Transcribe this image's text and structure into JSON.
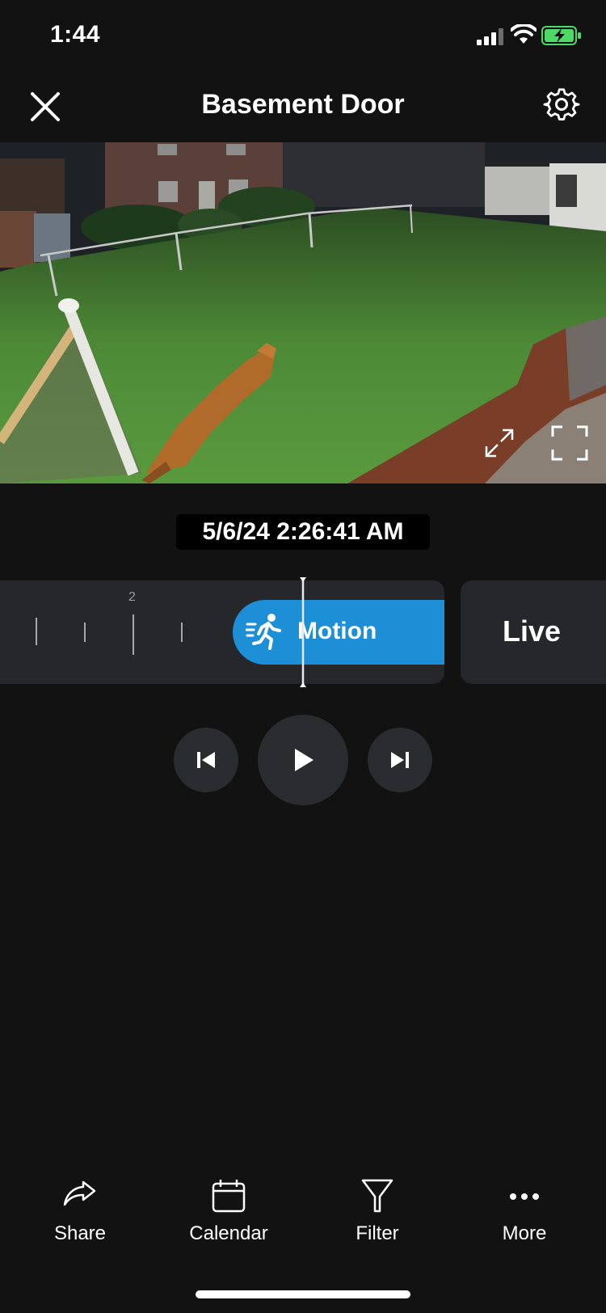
{
  "status_bar": {
    "time": "1:44",
    "battery_color": "#4cd964"
  },
  "header": {
    "title": "Basement Door"
  },
  "video": {
    "description_icons": [
      "expand-icon",
      "fullscreen-icon"
    ]
  },
  "timestamp": "5/6/24 2:26:41 AM",
  "timeline": {
    "tick_label": "2",
    "event_label": "Motion",
    "event_color": "#1d8fd6",
    "live_label": "Live"
  },
  "controls": {
    "icons": [
      "previous-icon",
      "play-icon",
      "next-icon"
    ]
  },
  "bottom_nav": {
    "items": [
      {
        "label": "Share",
        "icon": "share-icon"
      },
      {
        "label": "Calendar",
        "icon": "calendar-icon"
      },
      {
        "label": "Filter",
        "icon": "filter-icon"
      },
      {
        "label": "More",
        "icon": "more-icon"
      }
    ]
  }
}
